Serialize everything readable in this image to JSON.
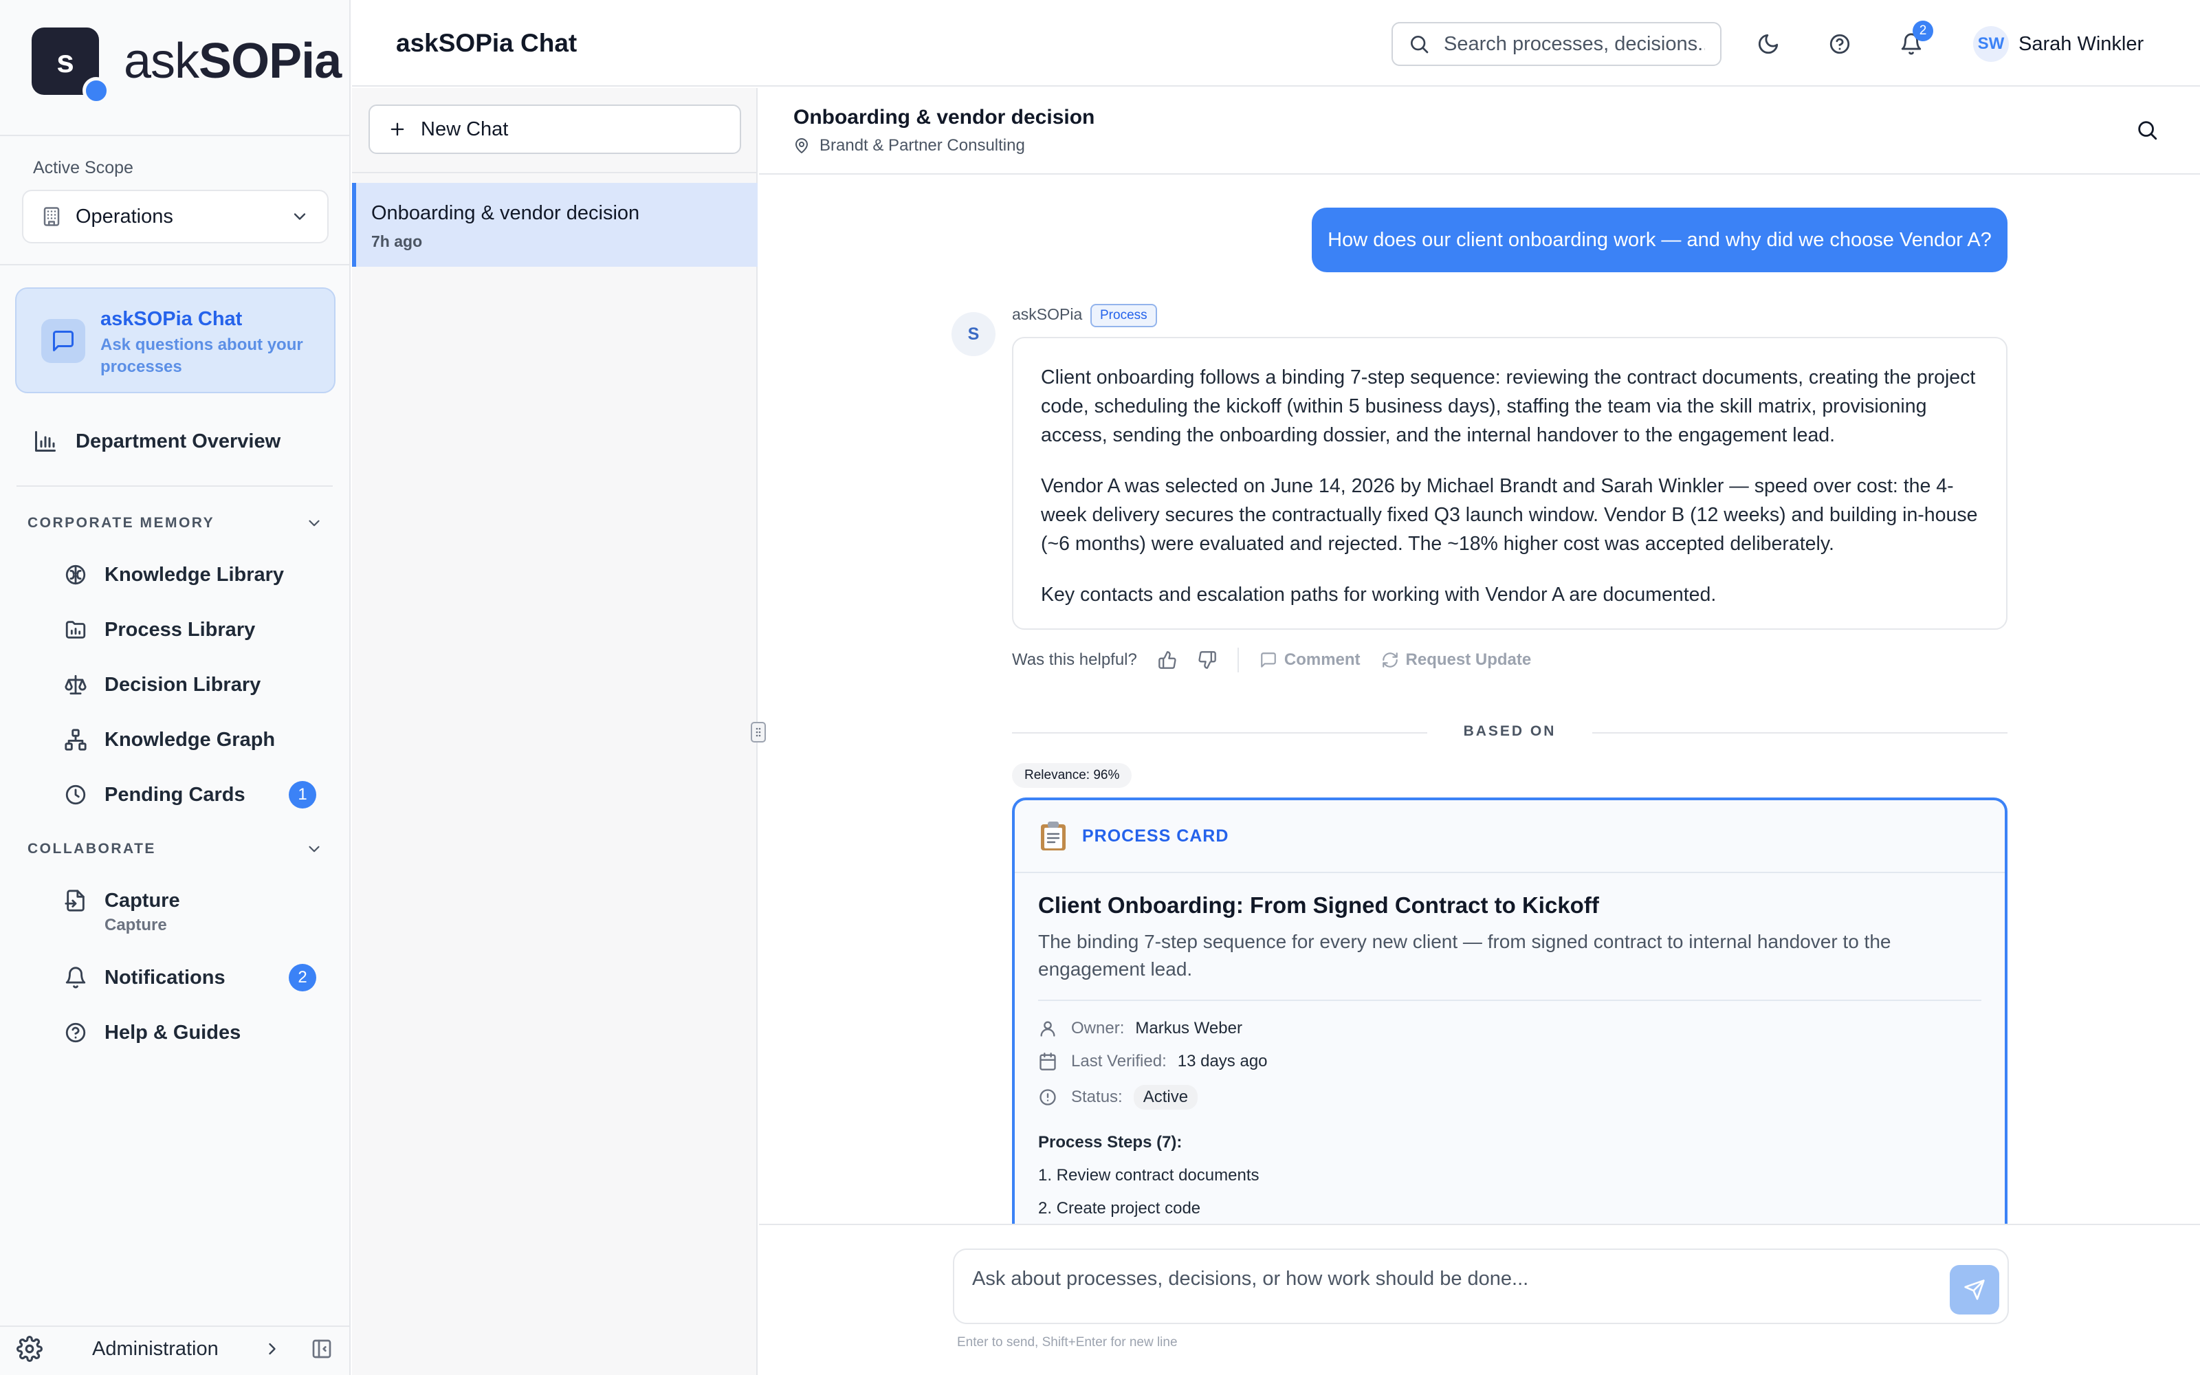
{
  "brand": {
    "logo_letter": "s",
    "name_prefix": "ask",
    "name_suffix": "SOPia"
  },
  "scope": {
    "label": "Active Scope",
    "value": "Operations"
  },
  "active_nav": {
    "title": "askSOPia Chat",
    "subtitle": "Ask questions about your processes"
  },
  "nav": {
    "department": "Department Overview",
    "corporate_memory": {
      "heading": "CORPORATE MEMORY",
      "items": [
        "Knowledge Library",
        "Process Library",
        "Decision Library",
        "Knowledge Graph",
        "Pending Cards"
      ],
      "pending_count": "1"
    },
    "collaborate": {
      "heading": "COLLABORATE",
      "capture": "Capture",
      "capture_sub": "Capture",
      "notifications": "Notifications",
      "notifications_count": "2",
      "help": "Help & Guides"
    },
    "administration": "Administration"
  },
  "header": {
    "title": "askSOPia Chat",
    "search_placeholder": "Search processes, decisions...",
    "bell_count": "2",
    "user_initials": "SW",
    "user_name": "Sarah Winkler"
  },
  "chat_list": {
    "new_chat": "New Chat",
    "items": [
      {
        "title": "Onboarding & vendor decision",
        "time": "7h ago"
      }
    ]
  },
  "conversation": {
    "title": "Onboarding & vendor decision",
    "org": "Brandt & Partner Consulting",
    "user_message": "How does our client onboarding work — and why did we choose Vendor A?",
    "bot_initial": "S",
    "bot_name": "askSOPia",
    "bot_tag": "Process",
    "answer": [
      "Client onboarding follows a binding 7-step sequence: reviewing the contract documents, creating the project code, scheduling the kickoff (within 5 business days), staffing the team via the skill matrix, provisioning access, sending the onboarding dossier, and the internal handover to the engagement lead.",
      "Vendor A was selected on June 14, 2026 by Michael Brandt and Sarah Winkler — speed over cost: the 4-week delivery secures the contractually fixed Q3 launch window. Vendor B (12 weeks) and building in-house (~6 months) were evaluated and rejected. The ~18% higher cost was accepted deliberately.",
      "Key contacts and escalation paths for working with Vendor A are documented."
    ],
    "feedback": {
      "question": "Was this helpful?",
      "comment": "Comment",
      "request_update": "Request Update"
    },
    "based_on": "BASED ON",
    "relevance": "Relevance: 96%",
    "card": {
      "type_label": "PROCESS CARD",
      "title": "Client Onboarding: From Signed Contract to Kickoff",
      "description": "The binding 7-step sequence for every new client — from signed contract to internal handover to the engagement lead.",
      "owner_label": "Owner:",
      "owner": "Markus Weber",
      "verified_label": "Last Verified:",
      "verified": "13 days ago",
      "status_label": "Status:",
      "status": "Active",
      "steps_heading": "Process Steps (7):",
      "steps": [
        "1. Review contract documents",
        "2. Create project code"
      ]
    },
    "composer_placeholder": "Ask about processes, decisions, or how work should be done...",
    "composer_hint": "Enter to send, Shift+Enter for new line"
  },
  "colors": {
    "accent": "#3b82f6",
    "brand_dark": "#1f2233",
    "active_bg": "#dbe8fb"
  }
}
